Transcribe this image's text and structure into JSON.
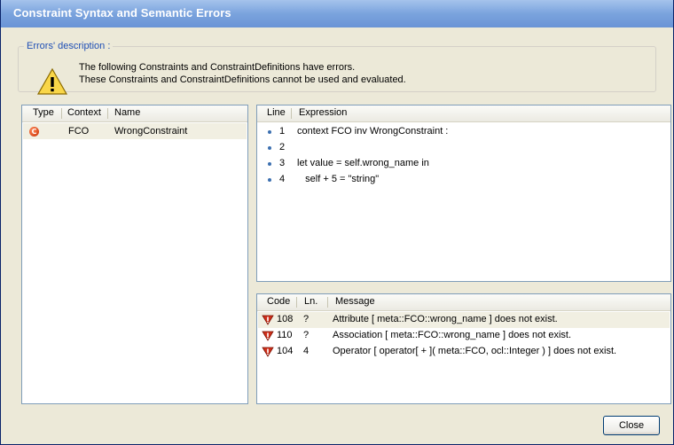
{
  "window": {
    "title": "Constraint Syntax and Semantic Errors"
  },
  "description": {
    "legend": "Errors' description :",
    "line1": "The following Constraints and ConstraintDefinitions have errors.",
    "line2": "These Constraints and ConstraintDefinitions cannot be used and evaluated."
  },
  "constraints_list": {
    "headers": {
      "type": "Type",
      "context": "Context",
      "name": "Name"
    },
    "rows": [
      {
        "type_icon": "constraint-c-icon",
        "type_letter": "C",
        "context": "FCO",
        "name": "WrongConstraint"
      }
    ]
  },
  "expression_list": {
    "headers": {
      "line": "Line",
      "expression": "Expression"
    },
    "rows": [
      {
        "line": "1",
        "text": "context FCO inv WrongConstraint :"
      },
      {
        "line": "2",
        "text": ""
      },
      {
        "line": "3",
        "text": "let value = self.wrong_name in"
      },
      {
        "line": "4",
        "text": "   self + 5 = \"string\""
      }
    ]
  },
  "messages_list": {
    "headers": {
      "code": "Code",
      "ln": "Ln.",
      "message": "Message"
    },
    "rows": [
      {
        "icon": "error-v-icon",
        "code": "108",
        "ln": "?",
        "message": "Attribute [ meta::FCO::wrong_name ] does not exist."
      },
      {
        "icon": "error-v-icon",
        "code": "110",
        "ln": "?",
        "message": "Association [ meta::FCO::wrong_name ] does not exist."
      },
      {
        "icon": "error-v-icon",
        "code": "104",
        "ln": "4",
        "message": "Operator [ operator[ + ]( meta::FCO, ocl::Integer ) ] does not exist."
      }
    ]
  },
  "buttons": {
    "close": "Close"
  },
  "colors": {
    "titlebar": "#7aa3dd",
    "dialog_bg": "#ece9d8",
    "legend_text": "#1f4fb5",
    "error_icon": "#c62c00"
  }
}
